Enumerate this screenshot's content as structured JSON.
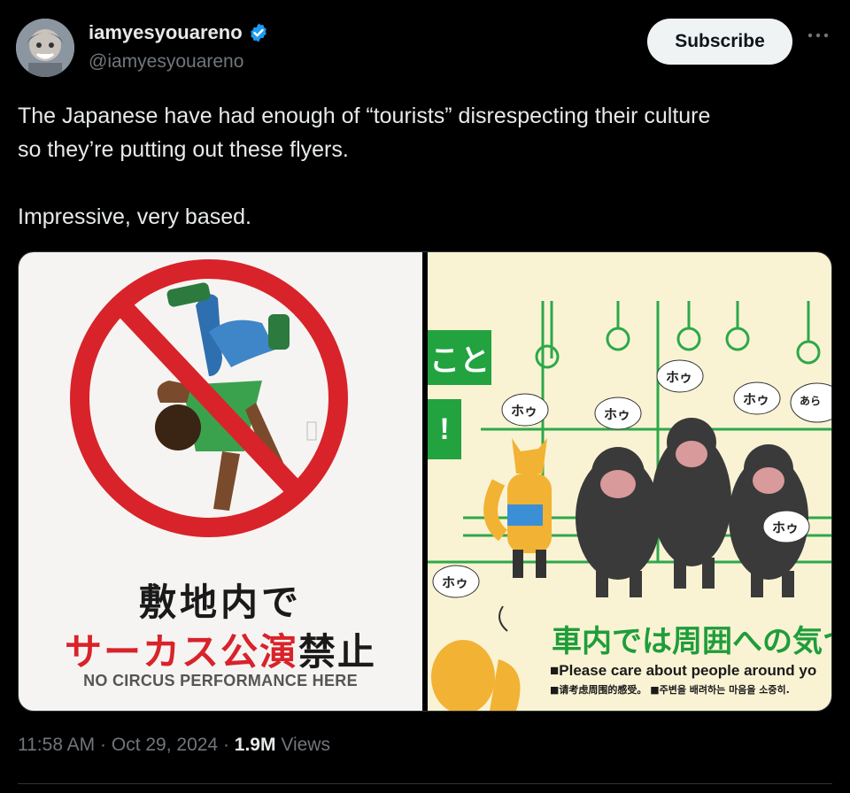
{
  "author": {
    "display_name": "iamyesyouareno",
    "handle": "@iamyesyouareno",
    "verified": true,
    "verified_color": "#1d9bf0"
  },
  "actions": {
    "subscribe_label": "Subscribe",
    "more_icon": "more-horizontal-icon"
  },
  "tweet": {
    "line1": "The Japanese have had enough of “tourists” disrespecting their culture",
    "line2": "so they’re putting out these flyers.",
    "line3": "Impressive, very based."
  },
  "media": {
    "left_flyer": {
      "jp_line1": "敷地内で",
      "jp_line2_red": "サーカス公演",
      "jp_line2_black": "禁止",
      "english": "NO CIRCUS PERFORMANCE HERE"
    },
    "right_flyer": {
      "top_box_text": "こと",
      "second_box_text": "!",
      "monkey_sound": "ホゥ",
      "corner_text": "あら",
      "heading_jp": "車内では周囲への気つ",
      "english": "■Please care about people around yo",
      "zh_ko": "■请考虑周围的感受。 ■주변을 배려하는 마음을 소중히."
    }
  },
  "meta": {
    "time": "11:58 AM",
    "date": "Oct 29, 2024",
    "views_count": "1.9M",
    "views_label": "Views",
    "separator": "·"
  },
  "colors": {
    "background": "#000000",
    "text_primary": "#e7e9ea",
    "text_secondary": "#71767b",
    "prohibition_red": "#d8232a",
    "flyer_green": "#22a33f"
  }
}
